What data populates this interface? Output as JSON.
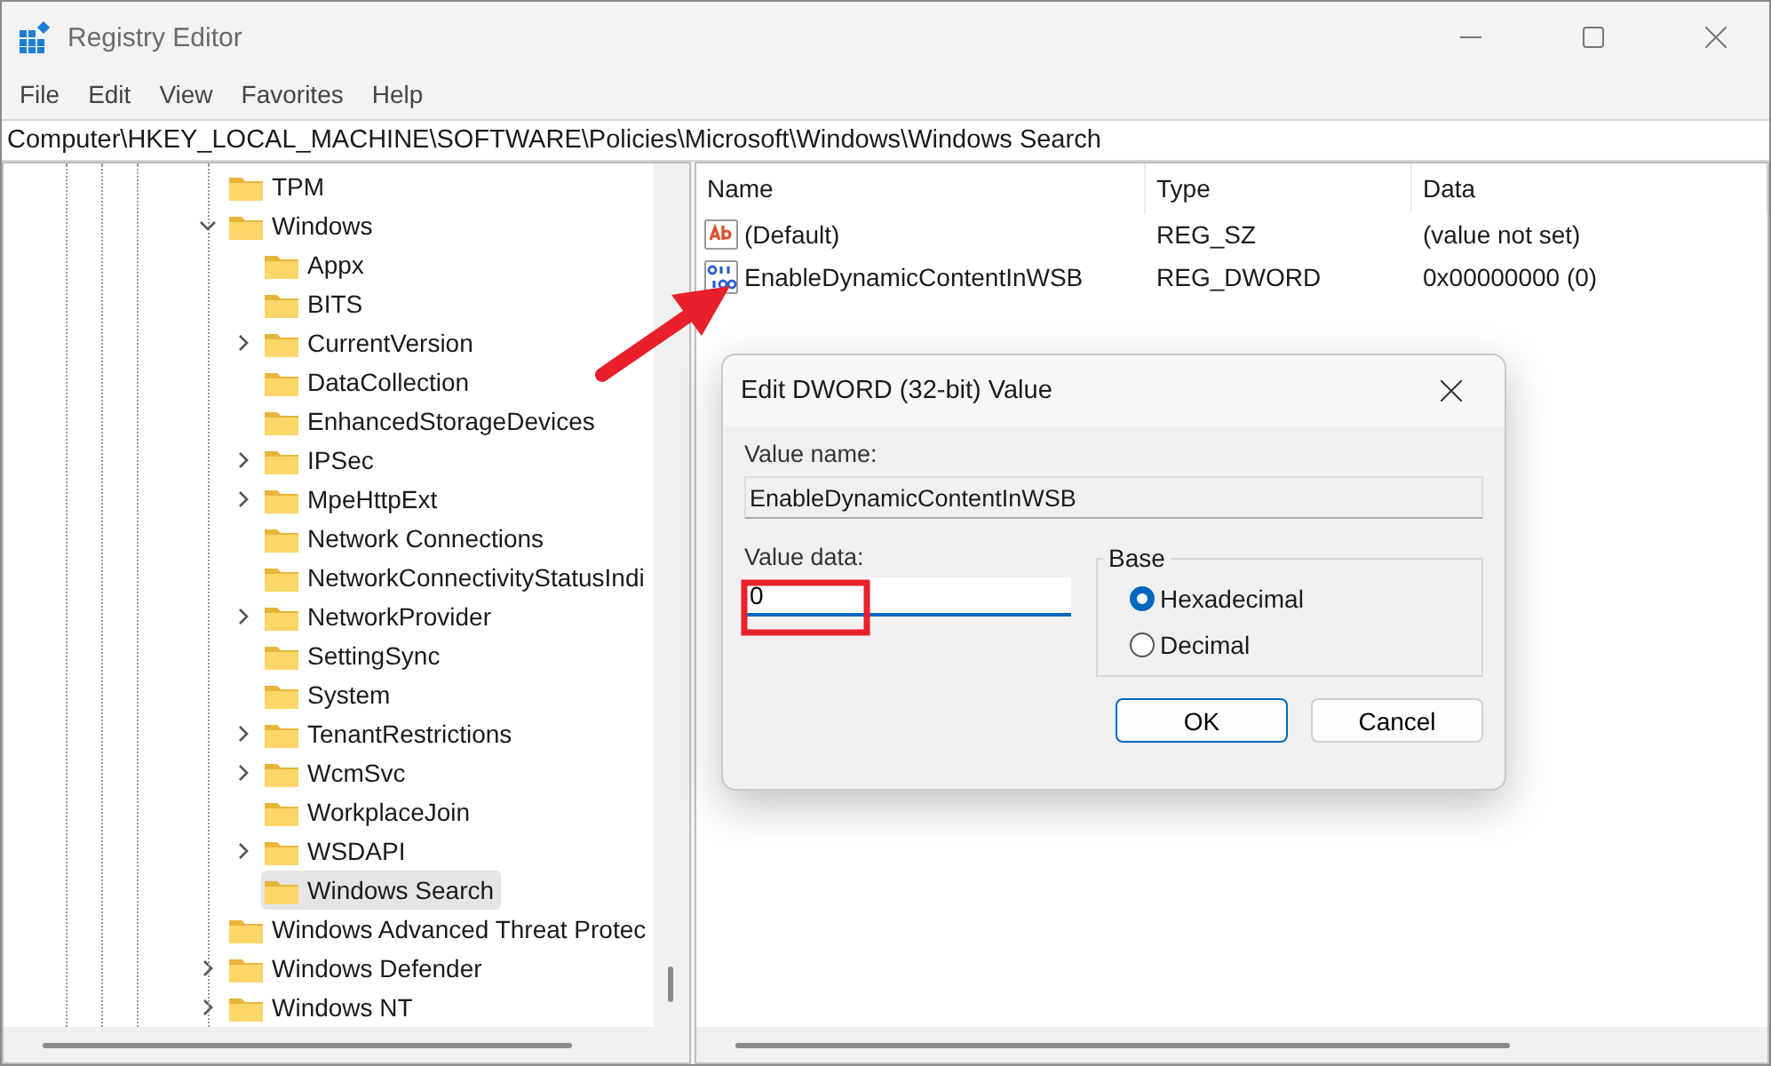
{
  "window": {
    "title": "Registry Editor"
  },
  "menu": [
    "File",
    "Edit",
    "View",
    "Favorites",
    "Help"
  ],
  "address": "Computer\\HKEY_LOCAL_MACHINE\\SOFTWARE\\Policies\\Microsoft\\Windows\\Windows Search",
  "tree": [
    {
      "label": "TPM",
      "has_children": false,
      "selected": false
    },
    {
      "label": "Windows",
      "has_children": true,
      "expanded": true,
      "selected": false,
      "children": [
        {
          "label": "Appx",
          "has_children": false,
          "selected": false
        },
        {
          "label": "BITS",
          "has_children": false,
          "selected": false
        },
        {
          "label": "CurrentVersion",
          "has_children": true,
          "expanded": false,
          "selected": false
        },
        {
          "label": "DataCollection",
          "has_children": false,
          "selected": false
        },
        {
          "label": "EnhancedStorageDevices",
          "has_children": false,
          "selected": false
        },
        {
          "label": "IPSec",
          "has_children": true,
          "expanded": false,
          "selected": false
        },
        {
          "label": "MpeHttpExt",
          "has_children": true,
          "expanded": false,
          "selected": false
        },
        {
          "label": "Network Connections",
          "has_children": false,
          "selected": false
        },
        {
          "label": "NetworkConnectivityStatusIndi",
          "has_children": false,
          "selected": false
        },
        {
          "label": "NetworkProvider",
          "has_children": true,
          "expanded": false,
          "selected": false
        },
        {
          "label": "SettingSync",
          "has_children": false,
          "selected": false
        },
        {
          "label": "System",
          "has_children": false,
          "selected": false
        },
        {
          "label": "TenantRestrictions",
          "has_children": true,
          "expanded": false,
          "selected": false
        },
        {
          "label": "WcmSvc",
          "has_children": true,
          "expanded": false,
          "selected": false
        },
        {
          "label": "WorkplaceJoin",
          "has_children": false,
          "selected": false
        },
        {
          "label": "WSDAPI",
          "has_children": true,
          "expanded": false,
          "selected": false
        },
        {
          "label": "Windows Search",
          "has_children": false,
          "selected": true
        }
      ]
    },
    {
      "label": "Windows Advanced Threat Protec",
      "has_children": false,
      "selected": false
    },
    {
      "label": "Windows Defender",
      "has_children": true,
      "expanded": false,
      "selected": false
    },
    {
      "label": "Windows NT",
      "has_children": true,
      "expanded": false,
      "selected": false
    }
  ],
  "values": {
    "columns": [
      "Name",
      "Type",
      "Data"
    ],
    "rows": [
      {
        "kind": "string",
        "name": "(Default)",
        "type": "REG_SZ",
        "data": "(value not set)"
      },
      {
        "kind": "dword",
        "name": "EnableDynamicContentInWSB",
        "type": "REG_DWORD",
        "data": "0x00000000 (0)"
      }
    ]
  },
  "dialog": {
    "title": "Edit DWORD (32-bit) Value",
    "name_label": "Value name:",
    "name_value": "EnableDynamicContentInWSB",
    "data_label": "Value data:",
    "data_value": "0",
    "base_label": "Base",
    "base_options": [
      {
        "label": "Hexadecimal",
        "selected": true
      },
      {
        "label": "Decimal",
        "selected": false
      }
    ],
    "buttons": [
      {
        "label": "OK",
        "kind": "default"
      },
      {
        "label": "Cancel",
        "kind": "normal"
      }
    ]
  }
}
